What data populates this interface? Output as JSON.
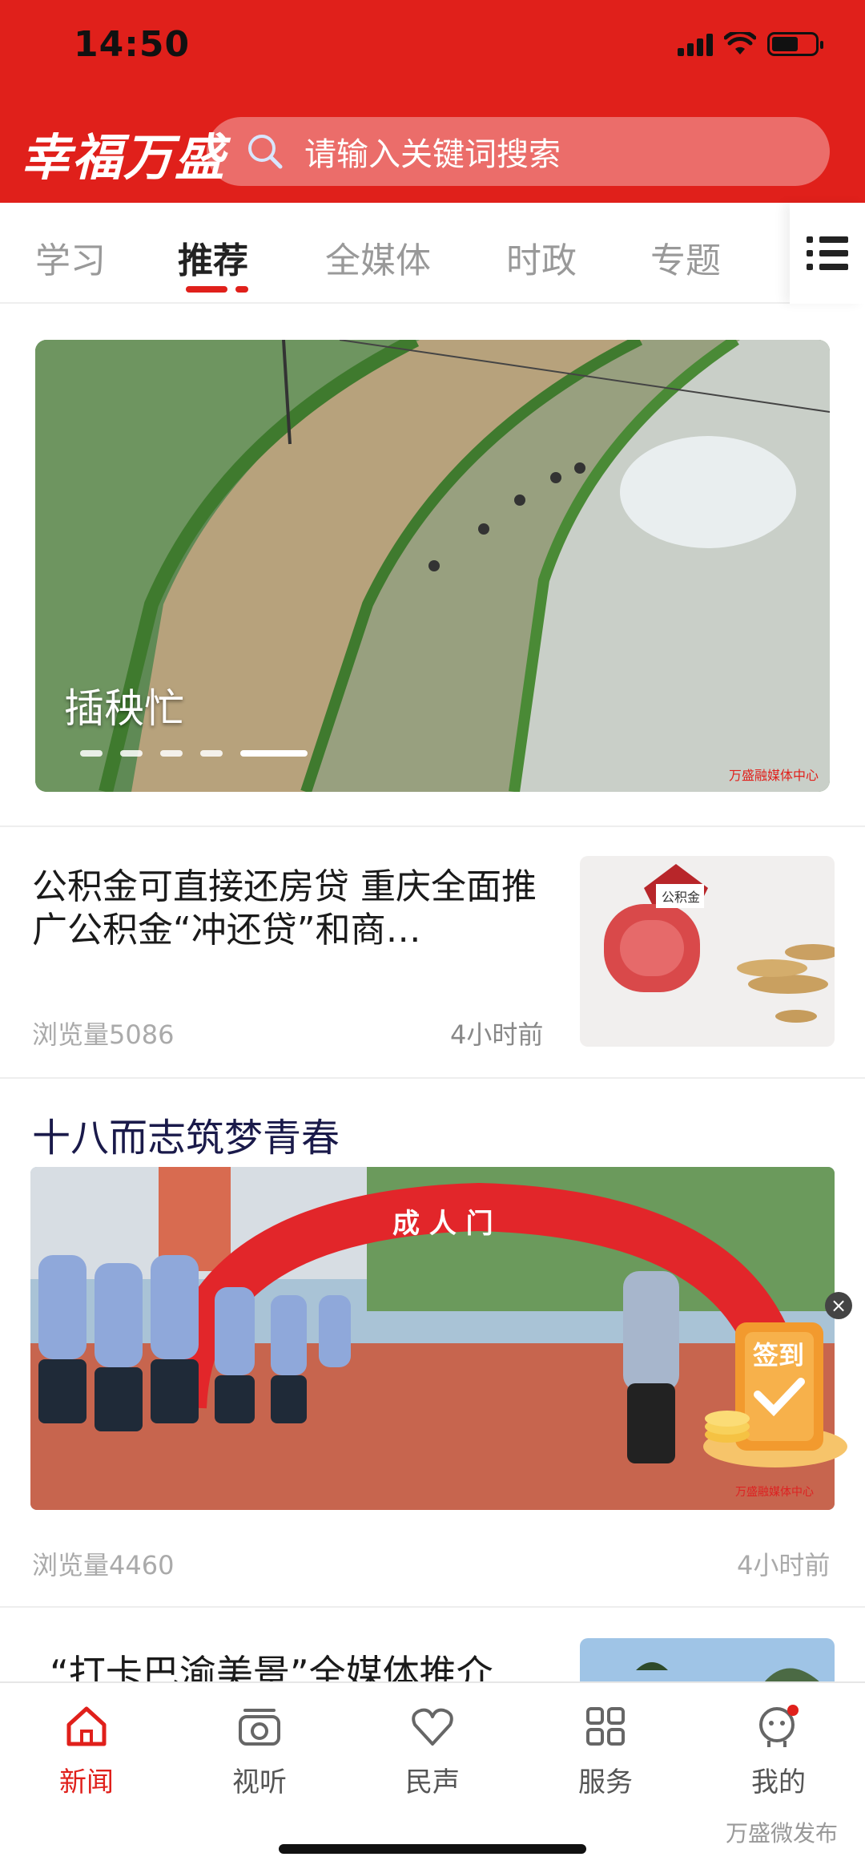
{
  "status_bar": {
    "time": "14:50"
  },
  "header": {
    "logo_text": "幸福万盛",
    "search_placeholder": "请输入关键词搜索"
  },
  "tabs": [
    {
      "label": "学习",
      "active": false
    },
    {
      "label": "推荐",
      "active": true
    },
    {
      "label": "全媒体",
      "active": false
    },
    {
      "label": "时政",
      "active": false
    },
    {
      "label": "专题",
      "active": false
    }
  ],
  "banner": {
    "caption": "插秧忙",
    "watermark": "万盛融媒体中心",
    "slide_count": 5,
    "active_slide": 5
  },
  "news": [
    {
      "title": "公积金可直接还房贷 重庆全面推广公积金“冲还贷”和商…",
      "views": "浏览量5086",
      "time": "4小时前",
      "thumb_label": "公积金"
    },
    {
      "title": "十八而志筑梦青春",
      "views": "浏览量4460",
      "time": "4小时前",
      "arch_text": "成 人 门",
      "watermark": "万盛融媒体中心"
    },
    {
      "title": "“打卡巴渝美景”全媒体推介"
    }
  ],
  "checkin": {
    "label": "签到"
  },
  "bottom_nav": [
    {
      "label": "新闻",
      "icon": "home-icon",
      "active": true
    },
    {
      "label": "视听",
      "icon": "radio-icon",
      "active": false
    },
    {
      "label": "民声",
      "icon": "heart-icon",
      "active": false
    },
    {
      "label": "服务",
      "icon": "grid-icon",
      "active": false
    },
    {
      "label": "我的",
      "icon": "user-icon",
      "active": false,
      "badge": true
    }
  ],
  "footer_mark": "万盛微发布",
  "colors": {
    "brand_red": "#e0201b"
  }
}
